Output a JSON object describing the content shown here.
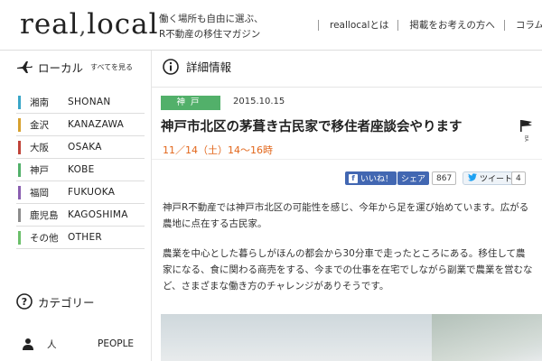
{
  "header": {
    "logo_left": "real",
    "logo_sep": ",",
    "logo_right": "local",
    "tagline_line1": "働く場所も自由に選ぶ、",
    "tagline_line2": "R不動産の移住マガジン",
    "nav": [
      "reallocalとは",
      "掲載をお考えの方へ",
      "コラム"
    ]
  },
  "sidebar": {
    "local_title": "ローカル",
    "see_all": "すべてを見る",
    "regions": [
      {
        "jp": "湘南",
        "en": "SHONAN",
        "color": "#3aa6c8"
      },
      {
        "jp": "金沢",
        "en": "KANAZAWA",
        "color": "#d7a12e"
      },
      {
        "jp": "大阪",
        "en": "OSAKA",
        "color": "#c0443a"
      },
      {
        "jp": "神戸",
        "en": "KOBE",
        "color": "#52b06a"
      },
      {
        "jp": "福岡",
        "en": "FUKUOKA",
        "color": "#8a5fb0"
      },
      {
        "jp": "鹿児島",
        "en": "KAGOSHIMA",
        "color": "#8c8c8c"
      },
      {
        "jp": "その他",
        "en": "OTHER",
        "color": "#6bbf6a"
      }
    ],
    "category_title": "カテゴリー",
    "categories": [
      {
        "jp": "人",
        "en": "PEOPLE"
      }
    ]
  },
  "main": {
    "section_title": "詳細情報",
    "tag": "神戸",
    "date": "2015.10.15",
    "title": "神戸市北区の茅葺き古民家で移住者座談会やります",
    "event_date": "11／14（土）14〜16時",
    "social": {
      "like": "いいね！",
      "share": "シェア",
      "fb_count": "867",
      "tweet": "ツイート",
      "tw_count": "4"
    },
    "para1": "神戸R不動産では神戸市北区の可能性を感じ、今年から足を運び始めています。広がる農地に点在する古民家。",
    "para2": "農業を中心とした暮らしがほんの都会から30分車で走ったところにある。移住して農家になる、食に関わる商売をする、今までの仕事を在宅でしながら副業で農業を営むなど、さまざまな働き方のチャレンジがありそうです。"
  },
  "colors": {
    "accent_green": "#52b06a",
    "event_orange": "#e2661a",
    "facebook": "#4267b2"
  }
}
